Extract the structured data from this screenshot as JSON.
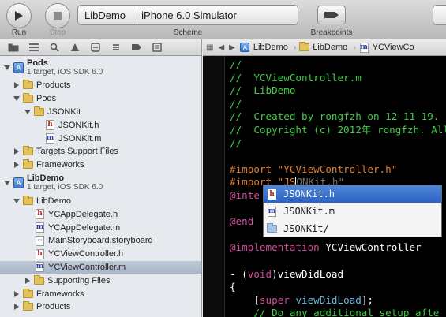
{
  "toolbar": {
    "run_label": "Run",
    "stop_label": "Stop",
    "scheme_target": "LibDemo",
    "scheme_destination": "iPhone 6.0 Simulator",
    "scheme_label": "Scheme",
    "breakpoints_label": "Breakpoints"
  },
  "navigator": {
    "pods_project": {
      "title": "Pods",
      "subtitle": "1 target, iOS SDK 6.0"
    },
    "pods_items": [
      {
        "label": "Products"
      },
      {
        "label": "Pods"
      },
      {
        "label": "JSONKit"
      },
      {
        "label": "JSONKit.h"
      },
      {
        "label": "JSONKit.m"
      },
      {
        "label": "Targets Support Files"
      },
      {
        "label": "Frameworks"
      }
    ],
    "libdemo_project": {
      "title": "LibDemo",
      "subtitle": "1 target, iOS SDK 6.0"
    },
    "libdemo_items": [
      {
        "label": "LibDemo"
      },
      {
        "label": "YCAppDelegate.h"
      },
      {
        "label": "YCAppDelegate.m"
      },
      {
        "label": "MainStoryboard.storyboard"
      },
      {
        "label": "YCViewController.h"
      },
      {
        "label": "YCViewController.m"
      },
      {
        "label": "Supporting Files"
      },
      {
        "label": "Frameworks"
      },
      {
        "label": "Products"
      }
    ]
  },
  "jumpbar": {
    "crumbs": [
      "LibDemo",
      "LibDemo",
      "YCViewCo"
    ]
  },
  "code": {
    "lines": [
      "//",
      "//  YCViewController.m",
      "//  LibDemo",
      "//",
      "//  Created by rongfzh on 12-11-19.",
      "//  Copyright (c) 2012年 rongfzh. All",
      "//",
      "",
      "#import \"YCViewController.h\"",
      "#import \"JS",
      "ONKit.h\"",
      "@inte",
      "@end",
      "@implementation",
      " YCViewController",
      "- (",
      "void",
      ")viewDidLoad",
      "{",
      "    [",
      "super",
      "viewDidLoad",
      "];",
      "    // Do any additional setup afte",
      "}"
    ]
  },
  "completion": {
    "items": [
      "JSONKit.h",
      "JSONKit.m",
      "JSONKit/"
    ]
  }
}
